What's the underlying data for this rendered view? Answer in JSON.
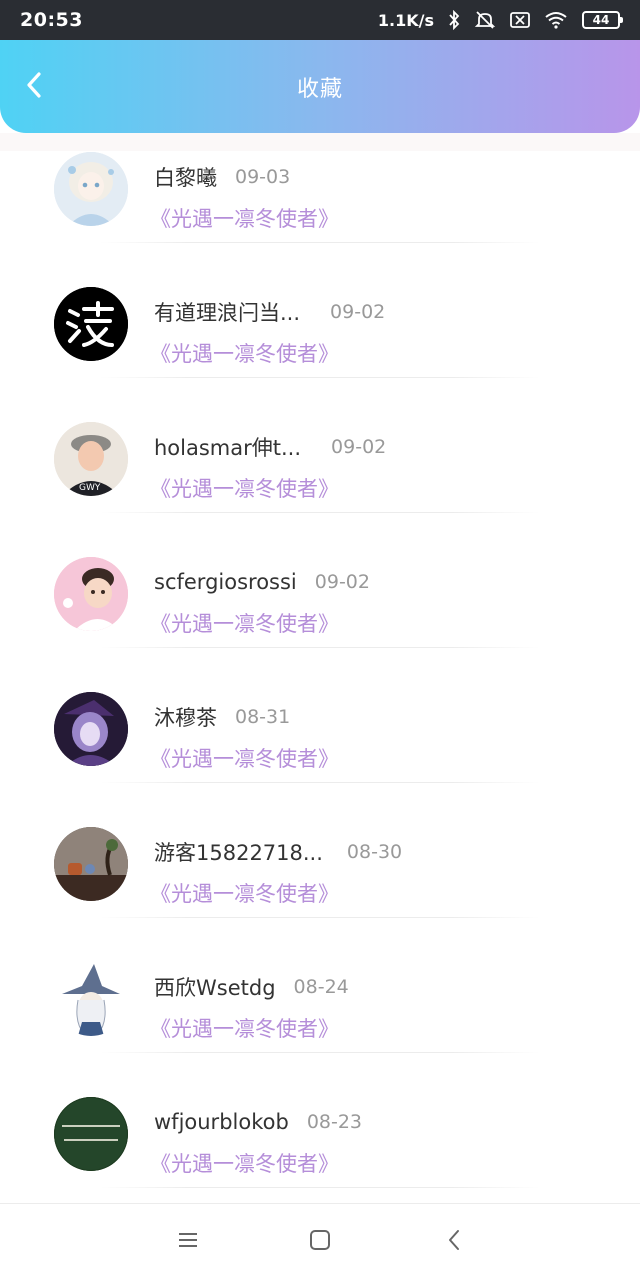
{
  "status_bar": {
    "time": "20:53",
    "network_speed": "1.1K/s",
    "battery": "44",
    "icons": [
      "bluetooth-icon",
      "mute-icon",
      "sim-x-icon",
      "wifi-icon",
      "battery-icon"
    ]
  },
  "header": {
    "title": "收藏",
    "back_icon": "chevron-left-icon",
    "gradient": [
      "#4fd2f4",
      "#8ab8ee",
      "#b895ea"
    ]
  },
  "colors": {
    "work_title": "#b58ed9",
    "name": "#333333",
    "date": "#999999"
  },
  "favorites": [
    {
      "name": "白黎曦",
      "date": "09-03",
      "work": "《光遇一凛冬使者》",
      "avatar": "anime-girl-avatar"
    },
    {
      "name": "有道理浪闩当...",
      "date": "09-02",
      "work": "《光遇一凛冬使者》",
      "avatar": "glyph-avatar"
    },
    {
      "name": "holasmar伸t...",
      "date": "09-02",
      "work": "《光遇一凛冬使者》",
      "avatar": "person-cap-avatar"
    },
    {
      "name": "scfergiosrossi",
      "date": "09-02",
      "work": "《光遇一凛冬使者》",
      "avatar": "baby-avatar"
    },
    {
      "name": "沐穆茶",
      "date": "08-31",
      "work": "《光遇一凛冬使者》",
      "avatar": "purple-witch-avatar"
    },
    {
      "name": "游客15822718...",
      "date": "08-30",
      "work": "《光遇一凛冬使者》",
      "avatar": "tea-scene-avatar"
    },
    {
      "name": "西欣Wsetdg",
      "date": "08-24",
      "work": "《光遇一凛冬使者》",
      "avatar": "wizard-avatar"
    },
    {
      "name": "wfjourblokob",
      "date": "08-23",
      "work": "《光遇一凛冬使者》",
      "avatar": "green-text-avatar"
    }
  ],
  "nav_bar": {
    "icons": [
      "menu-icon",
      "home-square-icon",
      "back-arrow-icon"
    ]
  }
}
